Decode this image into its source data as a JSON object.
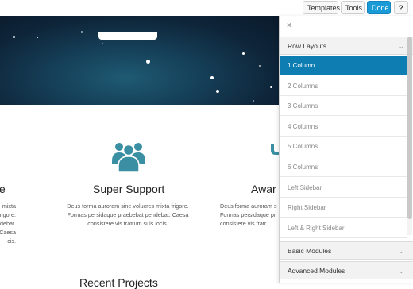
{
  "toolbar": {
    "templates": "Templates",
    "tools": "Tools",
    "done": "Done",
    "help": "?"
  },
  "features": [
    {
      "title": "e",
      "text": [
        "mixta frigore.",
        "debat. Caesa",
        "cis."
      ]
    },
    {
      "title": "Super Support",
      "text": [
        "Deus forma auroram sine volucres mixta frigore.",
        "Formas persidaque praebebat pendebat. Caesa",
        "consistere vis fratrum suis locis."
      ]
    },
    {
      "title": "Awar",
      "text": [
        "Deus forma auroram s",
        "Formas persidaque pr",
        "consistere vis fratr"
      ]
    }
  ],
  "bottom_heading": "Recent Projects",
  "panel": {
    "close": "×",
    "row_layouts_label": "Row Layouts",
    "layouts": [
      "1 Column",
      "2 Columns",
      "3 Columns",
      "4 Columns",
      "5 Columns",
      "6 Columns",
      "Left Sidebar",
      "Right Sidebar",
      "Left & Right Sidebar"
    ],
    "active_index": 0,
    "basic_modules_label": "Basic Modules",
    "advanced_modules_label": "Advanced Modules"
  },
  "colors": {
    "accent": "#1a9bd7",
    "active_item": "#0e7db1",
    "icon_teal": "#3a8fa3"
  }
}
